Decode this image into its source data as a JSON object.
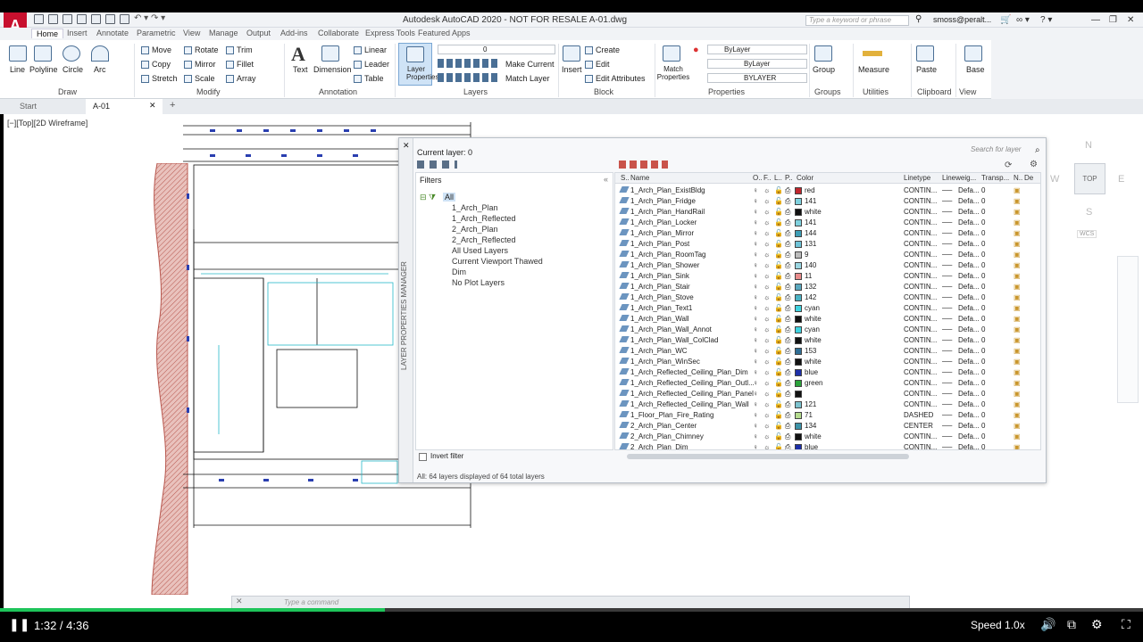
{
  "app": {
    "title": "Autodesk AutoCAD 2020 - NOT FOR RESALE    A-01.dwg",
    "search_placeholder": "Type a keyword or phrase",
    "user": "smoss@peralt...",
    "logo": "A"
  },
  "ribbon_tabs": [
    "Home",
    "Insert",
    "Annotate",
    "Parametric",
    "View",
    "Manage",
    "Output",
    "Add-ins",
    "Collaborate",
    "Express Tools",
    "Featured Apps"
  ],
  "ribbon": {
    "draw": {
      "group": "Draw",
      "items": [
        "Line",
        "Polyline",
        "Circle",
        "Arc"
      ]
    },
    "modify": {
      "group": "Modify",
      "items": [
        "Move",
        "Rotate",
        "Trim",
        "Copy",
        "Mirror",
        "Fillet",
        "Stretch",
        "Scale",
        "Array"
      ]
    },
    "annotation": {
      "group": "Annotation",
      "items": [
        "Text",
        "Dimension",
        "Linear",
        "Leader",
        "Table"
      ]
    },
    "layers": {
      "group": "Layers",
      "layer_properties": "Layer Properties",
      "current_layer_value": "0",
      "make_current": "Make Current",
      "match_layer": "Match Layer"
    },
    "block": {
      "group": "Block",
      "insert": "Insert",
      "create": "Create",
      "edit": "Edit",
      "edit_attributes": "Edit Attributes"
    },
    "properties": {
      "group": "Properties",
      "match": "Match Properties",
      "color": "ByLayer",
      "linetype": "ByLayer",
      "lineweight": "BYLAYER"
    },
    "groups": {
      "group": "Groups",
      "label": "Group"
    },
    "utilities": {
      "group": "Utilities",
      "label": "Measure"
    },
    "clipboard": {
      "group": "Clipboard",
      "label": "Paste"
    },
    "view": {
      "group": "View",
      "label": "Base"
    }
  },
  "file_tabs": [
    "Start",
    "A-01"
  ],
  "viewport_label": "[−][Top][2D Wireframe]",
  "layer_manager": {
    "vertical_title": "LAYER PROPERTIES MANAGER",
    "current_layer": "Current layer: 0",
    "search_placeholder": "Search for layer",
    "filters_header": "Filters",
    "filters": [
      "All",
      "1_Arch_Plan",
      "1_Arch_Reflected",
      "2_Arch_Plan",
      "2_Arch_Reflected",
      "All Used Layers",
      "Current Viewport Thawed",
      "Dim",
      "No Plot Layers"
    ],
    "invert_filter": "Invert filter",
    "status": "All: 64 layers displayed of 64 total layers",
    "columns": [
      "S..",
      "Name",
      "O..",
      "F..",
      "L..",
      "P..",
      "Color",
      "Linetype",
      "Lineweig...",
      "Transp...",
      "N..",
      "De"
    ],
    "rows": [
      {
        "name": "1_Arch_Plan_ExistBldg",
        "color": "red",
        "hex": "#c0262d",
        "linetype": "CONTIN...",
        "lw": "Defa...",
        "tr": "0"
      },
      {
        "name": "1_Arch_Plan_Fridge",
        "color": "141",
        "hex": "#7fd1de",
        "linetype": "CONTIN...",
        "lw": "Defa...",
        "tr": "0"
      },
      {
        "name": "1_Arch_Plan_HandRail",
        "color": "white",
        "hex": "#111111",
        "linetype": "CONTIN...",
        "lw": "Defa...",
        "tr": "0"
      },
      {
        "name": "1_Arch_Plan_Locker",
        "color": "141",
        "hex": "#7fd1de",
        "linetype": "CONTIN...",
        "lw": "Defa...",
        "tr": "0"
      },
      {
        "name": "1_Arch_Plan_Mirror",
        "color": "144",
        "hex": "#3d9eb6",
        "linetype": "CONTIN...",
        "lw": "Defa...",
        "tr": "0"
      },
      {
        "name": "1_Arch_Plan_Post",
        "color": "131",
        "hex": "#6fc4d8",
        "linetype": "CONTIN...",
        "lw": "Defa...",
        "tr": "0"
      },
      {
        "name": "1_Arch_Plan_RoomTag",
        "color": "9",
        "hex": "#bcbcbc",
        "linetype": "CONTIN...",
        "lw": "Defa...",
        "tr": "0"
      },
      {
        "name": "1_Arch_Plan_Shower",
        "color": "140",
        "hex": "#9ad6e2",
        "linetype": "CONTIN...",
        "lw": "Defa...",
        "tr": "0"
      },
      {
        "name": "1_Arch_Plan_Sink",
        "color": "11",
        "hex": "#e88b8b",
        "linetype": "CONTIN...",
        "lw": "Defa...",
        "tr": "0"
      },
      {
        "name": "1_Arch_Plan_Stair",
        "color": "132",
        "hex": "#5aa8bf",
        "linetype": "CONTIN...",
        "lw": "Defa...",
        "tr": "0"
      },
      {
        "name": "1_Arch_Plan_Stove",
        "color": "142",
        "hex": "#4bb3c5",
        "linetype": "CONTIN...",
        "lw": "Defa...",
        "tr": "0"
      },
      {
        "name": "1_Arch_Plan_Text1",
        "color": "cyan",
        "hex": "#3fd3e0",
        "linetype": "CONTIN...",
        "lw": "Defa...",
        "tr": "0"
      },
      {
        "name": "1_Arch_Plan_Wall",
        "color": "white",
        "hex": "#111111",
        "linetype": "CONTIN...",
        "lw": "Defa...",
        "tr": "0"
      },
      {
        "name": "1_Arch_Plan_Wall_Annot",
        "color": "cyan",
        "hex": "#3fd3e0",
        "linetype": "CONTIN...",
        "lw": "Defa...",
        "tr": "0"
      },
      {
        "name": "1_Arch_Plan_Wall_ColClad",
        "color": "white",
        "hex": "#111111",
        "linetype": "CONTIN...",
        "lw": "Defa...",
        "tr": "0"
      },
      {
        "name": "1_Arch_Plan_WC",
        "color": "153",
        "hex": "#2f6e95",
        "linetype": "CONTIN...",
        "lw": "Defa...",
        "tr": "0"
      },
      {
        "name": "1_Arch_Plan_WinSec",
        "color": "white",
        "hex": "#111111",
        "linetype": "CONTIN...",
        "lw": "Defa...",
        "tr": "0"
      },
      {
        "name": "1_Arch_Reflected_Ceiling_Plan_Dim",
        "color": "blue",
        "hex": "#1d2fa8",
        "linetype": "CONTIN...",
        "lw": "Defa...",
        "tr": "0"
      },
      {
        "name": "1_Arch_Reflected_Ceiling_Plan_Outl...",
        "color": "green",
        "hex": "#2aa33a",
        "linetype": "CONTIN...",
        "lw": "Defa...",
        "tr": "0"
      },
      {
        "name": "1_Arch_Reflected_Ceiling_Plan_Panel",
        "color": "",
        "hex": "#111111",
        "linetype": "CONTIN...",
        "lw": "Defa...",
        "tr": "0"
      },
      {
        "name": "1_Arch_Reflected_Ceiling_Plan_Wall",
        "color": "121",
        "hex": "#7cc3cf",
        "linetype": "CONTIN...",
        "lw": "Defa...",
        "tr": "0"
      },
      {
        "name": "1_Floor_Plan_Fire_Rating",
        "color": "71",
        "hex": "#b5dc8e",
        "linetype": "DASHED",
        "lw": "Defa...",
        "tr": "0"
      },
      {
        "name": "2_Arch_Plan_Center",
        "color": "134",
        "hex": "#3c93a8",
        "linetype": "CENTER",
        "lw": "Defa...",
        "tr": "0"
      },
      {
        "name": "2_Arch_Plan_Chimney",
        "color": "white",
        "hex": "#111111",
        "linetype": "CONTIN...",
        "lw": "Defa...",
        "tr": "0"
      },
      {
        "name": "2_Arch_Plan_Dim",
        "color": "blue",
        "hex": "#1d2fa8",
        "linetype": "CONTIN...",
        "lw": "Defa...",
        "tr": "0"
      }
    ]
  },
  "viewcube": {
    "top": "TOP",
    "north": "N",
    "west": "W",
    "east": "E",
    "south": "S",
    "wcs": "WCS"
  },
  "command_placeholder": "Type a command",
  "player": {
    "time": "1:32 / 4:36",
    "speed": "Speed 1.0x",
    "progress": 0.337
  }
}
